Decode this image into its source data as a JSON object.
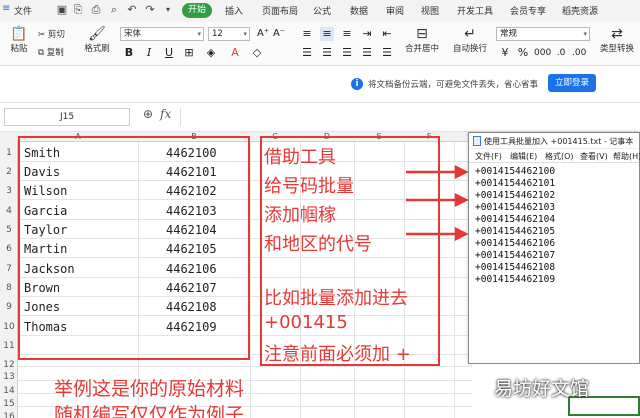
{
  "menu": {
    "file": "文件",
    "tabs": [
      "开始",
      "插入",
      "页面布局",
      "公式",
      "数据",
      "审阅",
      "视图",
      "开发工具",
      "会员专享",
      "稻壳资源"
    ]
  },
  "ribbon": {
    "paste": "粘贴",
    "cut": "剪切",
    "copy": "复制",
    "format_painter": "格式刷",
    "font_name": "宋体",
    "font_size": "12",
    "merge_center": "合并居中",
    "wrap_text": "自动换行",
    "number_format": "常规",
    "type_convert": "类型转换",
    "bold": "B",
    "italic": "I",
    "underline": "U"
  },
  "notice": {
    "text": "将文档备份云端，可避免文件丢失，省心省事",
    "login": "立即登录"
  },
  "formula_bar": {
    "cell_ref": "J15",
    "fx": "fx",
    "formula": ""
  },
  "grid": {
    "columns": [
      "A",
      "B",
      "C",
      "D",
      "E",
      "F"
    ],
    "rows": [
      "1",
      "2",
      "3",
      "4",
      "5",
      "6",
      "7",
      "8",
      "9",
      "10",
      "11",
      "12",
      "13",
      "14",
      "15",
      "16"
    ],
    "data": [
      {
        "name": "Smith",
        "num": "4462100"
      },
      {
        "name": "Davis",
        "num": "4462101"
      },
      {
        "name": "Wilson",
        "num": "4462102"
      },
      {
        "name": "Garcia",
        "num": "4462103"
      },
      {
        "name": "Taylor",
        "num": "4462104"
      },
      {
        "name": "Martin",
        "num": "4462105"
      },
      {
        "name": "Jackson",
        "num": "4462106"
      },
      {
        "name": "Brown",
        "num": "4462107"
      },
      {
        "name": "Jones",
        "num": "4462108"
      },
      {
        "name": "Thomas",
        "num": "4462109"
      }
    ]
  },
  "annotations": {
    "right_lines": [
      "借助工具",
      "给号码批量",
      "添加帼稼",
      "和地区的代号",
      "比如批量添加进去",
      "+001415",
      "注意前面必须加 +"
    ],
    "bottom_lines": [
      "举例这是你的原始材料",
      "随机编写仅仅作为例子"
    ]
  },
  "notepad": {
    "title": "使用工具批量加入 +001415.txt - 记事本",
    "menus": [
      "文件(F)",
      "编辑(E)",
      "格式(O)",
      "查看(V)",
      "帮助(H)"
    ],
    "lines": [
      "+0014154462100",
      "+0014154462101",
      "+0014154462102",
      "+0014154462103",
      "+0014154462104",
      "+0014154462105",
      "+0014154462106",
      "+0014154462107",
      "+0014154462108",
      "+0014154462109"
    ]
  },
  "watermark": "易坊好文馆",
  "colors": {
    "accent_green": "#2f9e44",
    "annotation_red": "#e53935",
    "login_blue": "#1a73e8"
  }
}
